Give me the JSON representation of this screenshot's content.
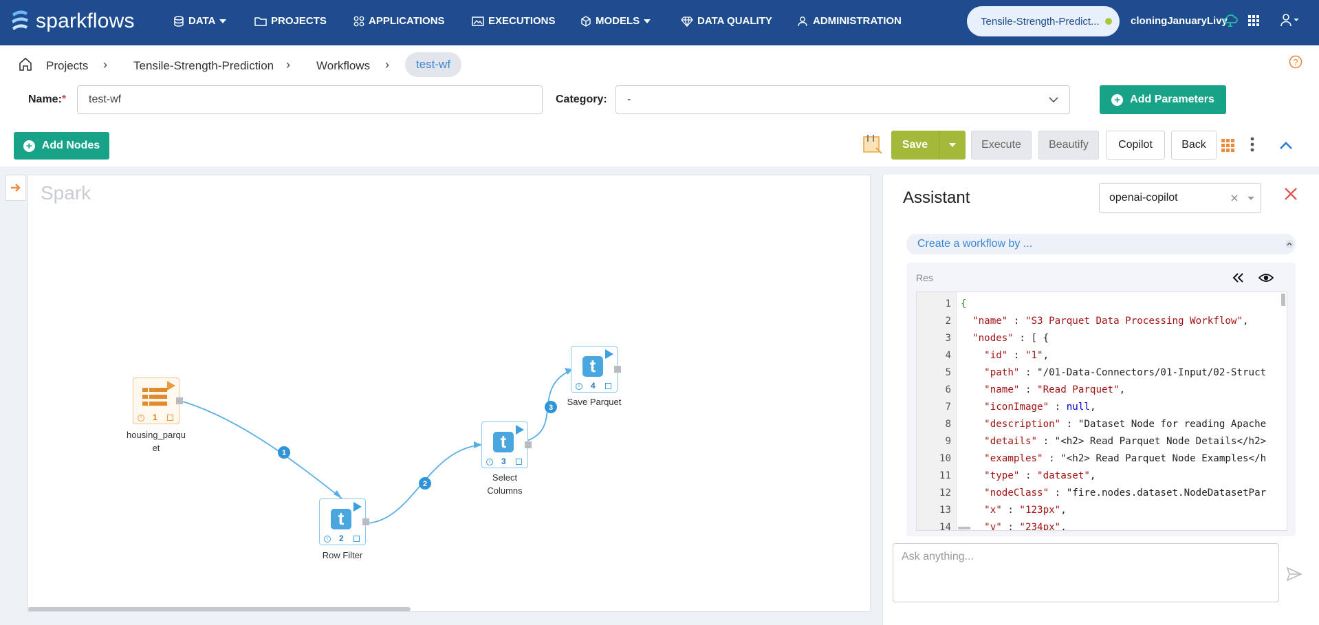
{
  "brand": {
    "name": "sparkflows",
    "accent": "#1e4c8f"
  },
  "nav": {
    "items": [
      {
        "label": "DATA",
        "icon": "database-icon",
        "dropdown": true
      },
      {
        "label": "PROJECTS",
        "icon": "folder-icon",
        "dropdown": false
      },
      {
        "label": "APPLICATIONS",
        "icon": "apps-grid-icon",
        "dropdown": false
      },
      {
        "label": "EXECUTIONS",
        "icon": "image-chart-icon",
        "dropdown": false
      },
      {
        "label": "MODELS",
        "icon": "cube-icon",
        "dropdown": true
      },
      {
        "label": "DATA QUALITY",
        "icon": "diamond-icon",
        "dropdown": false
      },
      {
        "label": "ADMINISTRATION",
        "icon": "user-gear-icon",
        "dropdown": false
      }
    ],
    "project_pill": "Tensile-Strength-Predict...",
    "user": "cloningJanuaryLivy"
  },
  "breadcrumb": {
    "items": [
      "Projects",
      "Tensile-Strength-Prediction",
      "Workflows"
    ],
    "current": "test-wf"
  },
  "form": {
    "name_label": "Name:",
    "name_required": "*",
    "name_value": "test-wf",
    "category_label": "Category:",
    "category_value": "-",
    "add_parameters": "Add Parameters"
  },
  "toolbar": {
    "add_nodes": "Add Nodes",
    "save": "Save",
    "execute": "Execute",
    "beautify": "Beautify",
    "copilot": "Copilot",
    "back": "Back"
  },
  "canvas": {
    "title": "Spark",
    "nodes": [
      {
        "num": "1",
        "label": "housing_parqu\net",
        "kind": "dataset"
      },
      {
        "num": "2",
        "label": "Row Filter",
        "kind": "transform"
      },
      {
        "num": "3",
        "label": "Select\nColumns",
        "kind": "transform"
      },
      {
        "num": "4",
        "label": "Save Parquet",
        "kind": "transform"
      }
    ],
    "edges": [
      "1",
      "2",
      "3"
    ]
  },
  "assistant": {
    "title": "Assistant",
    "model": "openai-copilot",
    "prompt": "Create a workflow by ...",
    "res_label": "Res",
    "code_lines": [
      "{",
      "  \"name\" : \"S3 Parquet Data Processing Workflow\",",
      "  \"nodes\" : [ {",
      "    \"id\" : \"1\",",
      "    \"path\" : \"/01-Data-Connectors/01-Input/02-Struct",
      "    \"name\" : \"Read Parquet\",",
      "    \"iconImage\" : null,",
      "    \"description\" : \"Dataset Node for reading Apache",
      "    \"details\" : \"<h2> Read Parquet Node Details</h2>",
      "    \"examples\" : \"<h2> Read Parquet Node Examples</h",
      "    \"type\" : \"dataset\",",
      "    \"nodeClass\" : \"fire.nodes.dataset.NodeDatasetPar",
      "    \"x\" : \"123px\",",
      "    \"y\" : \"234px\","
    ],
    "ask_placeholder": "Ask anything..."
  }
}
